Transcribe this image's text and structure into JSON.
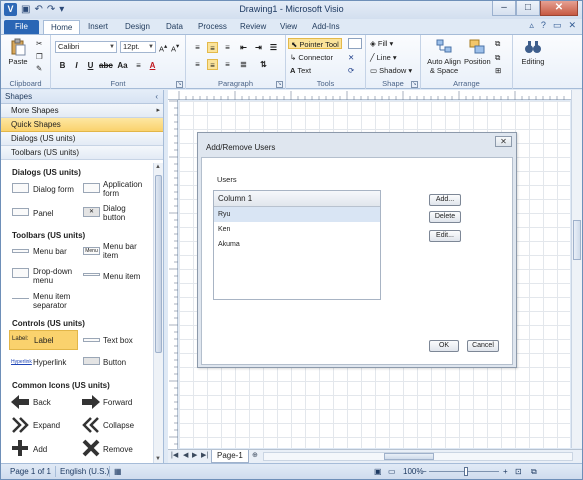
{
  "window": {
    "title": "Drawing1 - Microsoft Visio",
    "app_icon": "V",
    "minimize": "–",
    "maximize": "□",
    "close": "✕"
  },
  "tabs": [
    "File",
    "Home",
    "Insert",
    "Design",
    "Data",
    "Process",
    "Review",
    "View",
    "Add-Ins"
  ],
  "ribbon": {
    "clipboard": {
      "paste": "Paste",
      "label": "Clipboard"
    },
    "font": {
      "family": "Calibri",
      "size": "12pt.",
      "label": "Font"
    },
    "paragraph": {
      "label": "Paragraph"
    },
    "tools": {
      "pointer": "Pointer Tool",
      "connector": "Connector",
      "text": "Text",
      "label": "Tools"
    },
    "shape": {
      "fill": "Fill",
      "line": "Line",
      "shadow": "Shadow",
      "label": "Shape"
    },
    "arrange": {
      "auto_align": "Auto Align & Space",
      "position": "Position",
      "label": "Arrange"
    },
    "editing": {
      "label": "Editing"
    }
  },
  "shapes_pane": {
    "header": "Shapes",
    "stencils": [
      "More Shapes",
      "Quick Shapes",
      "Dialogs (US units)",
      "Toolbars (US units)"
    ],
    "sections": {
      "dialogs": {
        "title": "Dialogs (US units)",
        "items": [
          "Dialog form",
          "Application form",
          "Panel",
          "Dialog button"
        ]
      },
      "toolbars": {
        "title": "Toolbars (US units)",
        "items": [
          "Menu bar",
          "Menu bar item",
          "Drop-down menu",
          "Menu item",
          "Menu item separator"
        ],
        "menu_thumb_text": "Menu"
      },
      "controls": {
        "title": "Controls (US units)",
        "items": [
          "Label",
          "Text box",
          "Hyperlink",
          "Button"
        ],
        "label_thumb_text": "Label:",
        "hyperlink_thumb_text": "Hyperlink"
      },
      "icons": {
        "title": "Common Icons (US units)",
        "items": [
          "Back",
          "Forward",
          "Expand",
          "Collapse",
          "Add",
          "Remove"
        ]
      }
    }
  },
  "dialog": {
    "title": "Add/Remove Users",
    "close": "✕",
    "group_label": "Users",
    "column": "Column 1",
    "rows": [
      "Ryu",
      "Ken",
      "Akuma"
    ],
    "buttons": {
      "add": "Add...",
      "delete": "Delete",
      "edit": "Edit...",
      "ok": "OK",
      "cancel": "Cancel"
    }
  },
  "page_tabs": {
    "page": "Page-1"
  },
  "status": {
    "page": "Page 1 of 1",
    "language": "English (U.S.)",
    "zoom": "100%",
    "zoom_level": 1.0
  },
  "colors": {
    "accent": "#2a66b5",
    "highlight": "#fad26d"
  }
}
